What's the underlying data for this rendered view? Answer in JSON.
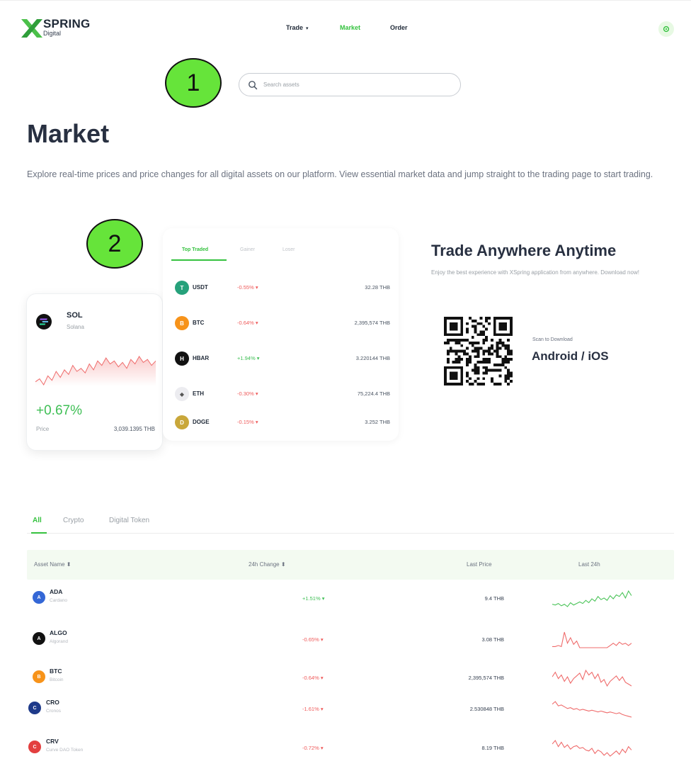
{
  "header": {
    "logo_word": "SPRING",
    "logo_sub": "Digital",
    "nav": [
      {
        "label": "Trade",
        "active": false,
        "has_caret": true
      },
      {
        "label": "Market",
        "active": true,
        "has_caret": false
      },
      {
        "label": "Order",
        "active": false,
        "has_caret": false
      }
    ],
    "settings_icon": "gear-icon"
  },
  "markers": [
    "1",
    "2"
  ],
  "search": {
    "placeholder": "Search assets",
    "value": ""
  },
  "page": {
    "title": "Market",
    "description": "Explore real-time prices and price changes for all digital assets on our platform. View essential market data and jump straight to the trading page to start trading."
  },
  "featured": {
    "symbol": "SOL",
    "name": "Solana",
    "change": "+0.67%",
    "price_label": "Price",
    "price": "3,039.1395 THB",
    "sparkline": [
      52,
      48,
      56,
      44,
      50,
      38,
      46,
      36,
      42,
      30,
      38,
      34,
      40,
      28,
      36,
      24,
      30,
      20,
      28,
      24,
      32,
      26,
      34,
      22,
      28,
      18,
      26,
      22,
      30,
      24
    ]
  },
  "ranking": {
    "tabs": [
      "Top Traded",
      "Gainer",
      "Loser"
    ],
    "active_tab": 0,
    "rows": [
      {
        "symbol": "USDT",
        "change": "-0.55%",
        "dir": "down",
        "price": "32.28 THB",
        "color": "#26a17b",
        "glyph": "T"
      },
      {
        "symbol": "BTC",
        "change": "-0.64%",
        "dir": "down",
        "price": "2,395,574 THB",
        "color": "#f7931a",
        "glyph": "B"
      },
      {
        "symbol": "HBAR",
        "change": "+1.94%",
        "dir": "up",
        "price": "3.220144 THB",
        "color": "#111111",
        "glyph": "H"
      },
      {
        "symbol": "ETH",
        "change": "-0.30%",
        "dir": "down",
        "price": "75,224.4 THB",
        "color": "#ececf0",
        "glyph": "◆"
      },
      {
        "symbol": "DOGE",
        "change": "-0.15%",
        "dir": "down",
        "price": "3.252 THB",
        "color": "#c9a73a",
        "glyph": "D"
      }
    ]
  },
  "promo": {
    "title": "Trade Anywhere Anytime",
    "description": "Enjoy the best experience with XSpring application from anywhere. Download now!",
    "scan_label": "Scan to Download",
    "platforms": "Android / iOS",
    "qr_icon": "qr-code-icon"
  },
  "categories": {
    "tabs": [
      "All",
      "Crypto",
      "Digital Token"
    ],
    "active": 0
  },
  "table": {
    "headers": {
      "asset": "Asset Name ⬍",
      "change": "24h Change ⬍",
      "price": "Last Price",
      "chart": "Last 24h"
    },
    "rows": [
      {
        "symbol": "ADA",
        "name": "Cardano",
        "change": "+1.51%",
        "dir": "up",
        "price": "9.4 THB",
        "color": "#3467d6",
        "glyph": "A",
        "spark": [
          60,
          62,
          58,
          64,
          60,
          66,
          56,
          62,
          58,
          54,
          58,
          50,
          56,
          46,
          52,
          40,
          48,
          44,
          50,
          38,
          46,
          36,
          40,
          30,
          44,
          26,
          38
        ]
      },
      {
        "symbol": "ALGO",
        "name": "Algorand",
        "change": "-0.65%",
        "dir": "down",
        "price": "3.08 THB",
        "color": "#111111",
        "glyph": "A",
        "spark": [
          60,
          60,
          58,
          60,
          34,
          54,
          44,
          56,
          50,
          62,
          62,
          62,
          62,
          62,
          62,
          62,
          62,
          62,
          62,
          58,
          54,
          58,
          52,
          56,
          54,
          58,
          54
        ]
      },
      {
        "symbol": "BTC",
        "name": "Bitcoin",
        "change": "-0.64%",
        "dir": "down",
        "price": "2,395,574 THB",
        "color": "#f7931a",
        "glyph": "B",
        "spark": [
          40,
          30,
          44,
          36,
          50,
          40,
          54,
          44,
          38,
          32,
          46,
          26,
          36,
          30,
          44,
          34,
          52,
          46,
          60,
          50,
          44,
          38,
          48,
          40,
          52,
          56,
          60
        ]
      },
      {
        "symbol": "CRO",
        "name": "Cronos",
        "change": "-1.61%",
        "dir": "down",
        "price": "2.530848 THB",
        "color": "#1e3a8a",
        "glyph": "C",
        "spark": [
          30,
          24,
          34,
          32,
          36,
          40,
          38,
          42,
          40,
          44,
          42,
          44,
          46,
          44,
          46,
          48,
          46,
          48,
          50,
          48,
          50,
          52,
          50,
          54,
          56,
          58,
          60
        ]
      },
      {
        "symbol": "CRV",
        "name": "Curve DAO Token",
        "change": "-0.72%",
        "dir": "down",
        "price": "8.19 THB",
        "color": "#e33f3f",
        "glyph": "C",
        "spark": [
          34,
          26,
          40,
          30,
          42,
          36,
          46,
          40,
          38,
          44,
          42,
          48,
          50,
          44,
          56,
          48,
          52,
          60,
          54,
          62,
          56,
          50,
          58,
          46,
          54,
          40,
          48
        ]
      }
    ]
  }
}
